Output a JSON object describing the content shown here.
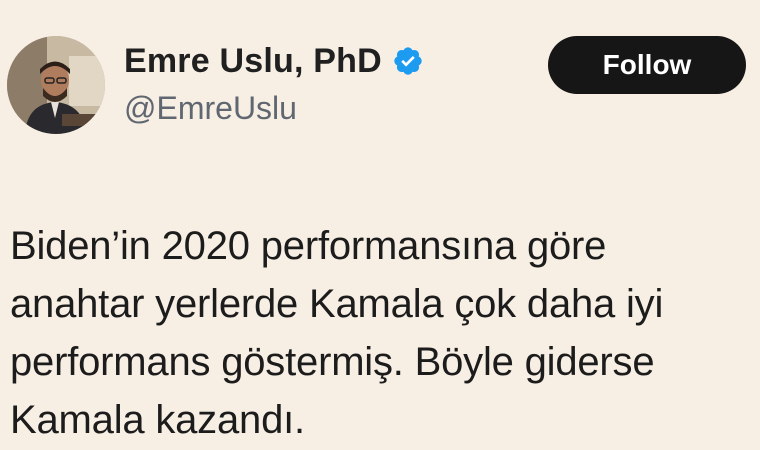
{
  "tweet": {
    "author": {
      "display_name": "Emre Uslu, PhD",
      "handle": "@EmreUslu",
      "verified": true,
      "verified_icon": "verified-badge-icon"
    },
    "follow_button_label": "Follow",
    "text_lines": [
      "Biden’in 2020 performansına göre",
      "anahtar yerlerde Kamala çok daha iyi",
      "performans göstermiş. Böyle giderse",
      "Kamala kazandı."
    ]
  },
  "colors": {
    "background": "#f7eee4",
    "follow_button_bg": "#161616",
    "follow_button_text": "#ffffff",
    "verified_badge": "#1d9bf0",
    "handle_text": "#606770"
  }
}
